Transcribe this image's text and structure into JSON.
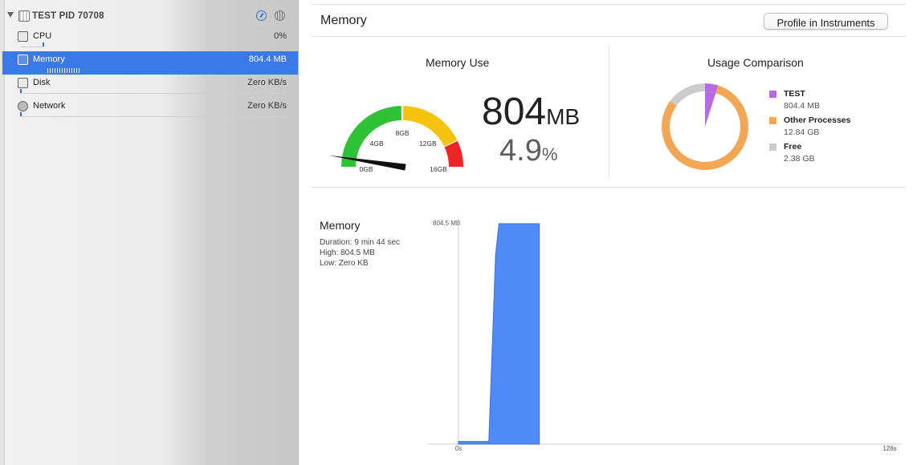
{
  "process": {
    "name": "TEST",
    "pid_label": "PID 70708"
  },
  "sidebar": {
    "items": [
      {
        "label": "CPU",
        "value": "0%"
      },
      {
        "label": "Memory",
        "value": "804.4 MB"
      },
      {
        "label": "Disk",
        "value": "Zero KB/s"
      },
      {
        "label": "Network",
        "value": "Zero KB/s"
      }
    ]
  },
  "main": {
    "title": "Memory",
    "profile_button": "Profile in Instruments",
    "memory_use": {
      "title": "Memory Use",
      "value": "804",
      "unit": "MB",
      "percent": "4.9",
      "percent_sign": "%",
      "gauge_labels": [
        "0GB",
        "4GB",
        "8GB",
        "12GB",
        "16GB"
      ],
      "gauge_fraction": 0.049
    },
    "usage_comparison": {
      "title": "Usage Comparison",
      "items": [
        {
          "name": "TEST",
          "value": "804.4 MB",
          "color": "#b86be0"
        },
        {
          "name": "Other Processes",
          "value": "12.84 GB",
          "color": "#f4a657"
        },
        {
          "name": "Free",
          "value": "2.38 GB",
          "color": "#cccccc"
        }
      ]
    },
    "memory_chart": {
      "title": "Memory",
      "duration": "Duration: 9 min 44 sec",
      "high": "High: 804.5 MB",
      "low": "Low: Zero KB"
    }
  },
  "chart_data": {
    "type": "area",
    "title": "Memory",
    "y_tick_label": "804.5 MB",
    "x_tick_labels": [
      "0s",
      "128s"
    ],
    "xlim": [
      0,
      128
    ],
    "ylim": [
      0,
      804.5
    ],
    "x": [
      0,
      9,
      11,
      12,
      24
    ],
    "values": [
      10,
      10,
      690,
      804.5,
      804.5
    ],
    "color": "#4f8bf7"
  }
}
